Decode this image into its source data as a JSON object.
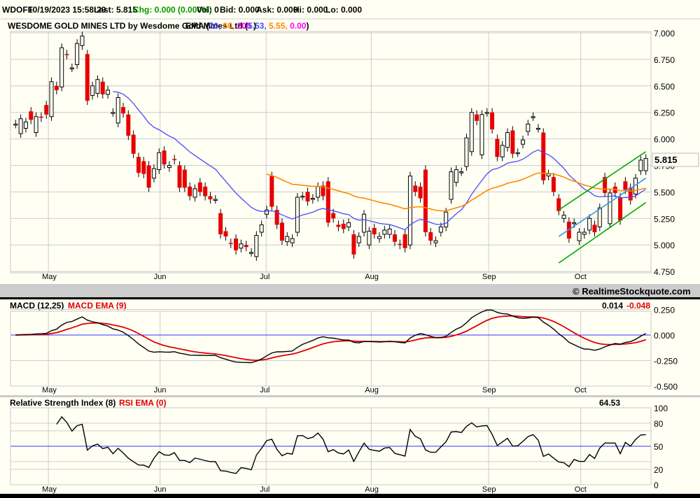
{
  "header": {
    "symbol": "WDOFF",
    "datetime": "10/19/2023 15:58:29",
    "last": "Last: 5.815",
    "chg": "Chg: 0.000 (0.000%)",
    "vol": "Vol: 0",
    "bid": "Bid: 0.000",
    "ask": "Ask: 0.000",
    "hi": "Hi: 0.000",
    "lo": "Lo: 0.000"
  },
  "legend": {
    "title": "WESDOME GOLD MINES LTD by Wesdome Gold Mines Ltd.",
    "ema_label": "EMA (",
    "ema_periods": [
      "20,",
      "50,",
      "200"
    ],
    "ema_close": ")",
    "val_open": "(",
    "ema_values": [
      "5.53,",
      "5.55,",
      "0.00"
    ],
    "val_close": ")"
  },
  "colors": {
    "up": "#fffff4",
    "down": "#e80000",
    "ema20": "#4a4aff",
    "ema50": "#ff8800",
    "ema200": "#ff00ff",
    "chg": "#009900",
    "channel": "#00aa00",
    "midline": "#3399ee",
    "macd": "#000000",
    "signal": "#e00000",
    "ref": "#3333ff"
  },
  "copyright": "© RealtimeStockquote.com",
  "last_price_tag": "5.815",
  "macd_panel": {
    "label": "MACD (12,25)",
    "signal_label": "MACD EMA (9)",
    "macd_value": "0.014",
    "signal_value": "-0.048",
    "ticks": [
      "0.250",
      "0.000",
      "-0.250",
      "-0.500"
    ],
    "tick_values": [
      0.25,
      0,
      -0.25,
      -0.5
    ]
  },
  "rsi_panel": {
    "label": "Relative Strength Index (8)",
    "ema_label": "RSI EMA (0)",
    "value": "64.53",
    "ticks": [
      "100",
      "80",
      "50",
      "20",
      "0"
    ],
    "tick_values": [
      100,
      80,
      50,
      20,
      0
    ]
  },
  "chart_data": {
    "type": "candlestick",
    "symbol": "WDOFF",
    "price_ticks": [
      "7.000",
      "6.750",
      "6.500",
      "6.250",
      "6.000",
      "5.750",
      "5.500",
      "5.250",
      "5.000",
      "4.750"
    ],
    "price_tick_values": [
      7.0,
      6.75,
      6.5,
      6.25,
      6.0,
      5.75,
      5.5,
      5.25,
      5.0,
      4.75
    ],
    "ylim": [
      4.75,
      7.0
    ],
    "months": [
      {
        "label": "May",
        "bar": 6.4
      },
      {
        "label": "Jun",
        "bar": 28.2
      },
      {
        "label": "Jul",
        "bar": 48.9
      },
      {
        "label": "Aug",
        "bar": 69.4
      },
      {
        "label": "Sep",
        "bar": 92.3
      },
      {
        "label": "Oct",
        "bar": 110.3
      }
    ],
    "bars_open_close": [
      [
        6.14,
        6.14
      ],
      [
        6.05,
        6.19
      ],
      [
        6.1,
        6.16
      ],
      [
        6.26,
        6.18
      ],
      [
        6.06,
        6.21
      ],
      [
        6.21,
        6.2
      ],
      [
        6.32,
        6.23
      ],
      [
        6.21,
        6.54
      ],
      [
        6.5,
        6.46
      ],
      [
        6.49,
        6.86
      ],
      [
        6.8,
        6.79
      ],
      [
        6.67,
        6.67
      ],
      [
        6.7,
        6.9
      ],
      [
        6.88,
        6.97
      ],
      [
        6.8,
        6.36
      ],
      [
        6.41,
        6.5
      ],
      [
        6.43,
        6.56
      ],
      [
        6.54,
        6.42
      ],
      [
        6.42,
        6.46
      ],
      [
        6.25,
        6.25
      ],
      [
        6.15,
        6.39
      ],
      [
        6.3,
        6.24
      ],
      [
        6.23,
        6.03
      ],
      [
        6.04,
        5.86
      ],
      [
        5.83,
        5.68
      ],
      [
        5.79,
        5.67
      ],
      [
        5.75,
        5.54
      ],
      [
        5.63,
        5.72
      ],
      [
        5.71,
        5.87
      ],
      [
        5.89,
        5.76
      ],
      [
        5.73,
        5.75
      ],
      [
        5.81,
        5.8
      ],
      [
        5.75,
        5.54
      ],
      [
        5.71,
        5.54
      ],
      [
        5.55,
        5.46
      ],
      [
        5.45,
        5.53
      ],
      [
        5.59,
        5.5
      ],
      [
        5.55,
        5.46
      ],
      [
        5.46,
        5.43
      ],
      [
        5.43,
        5.43
      ],
      [
        5.3,
        5.1
      ],
      [
        5.13,
        5.08
      ],
      [
        5.02,
        5.01
      ],
      [
        5.06,
        4.95
      ],
      [
        4.97,
        5.01
      ],
      [
        5.0,
        4.98
      ],
      [
        4.93,
        4.93
      ],
      [
        4.89,
        5.09
      ],
      [
        5.12,
        5.19
      ],
      [
        5.29,
        5.33
      ],
      [
        5.65,
        5.36
      ],
      [
        5.33,
        5.19
      ],
      [
        5.21,
        5.04
      ],
      [
        5.03,
        5.08
      ],
      [
        5.02,
        5.06
      ],
      [
        5.12,
        5.45
      ],
      [
        5.46,
        5.46
      ],
      [
        5.5,
        5.41
      ],
      [
        5.43,
        5.44
      ],
      [
        5.45,
        5.55
      ],
      [
        5.56,
        5.46
      ],
      [
        5.6,
        5.21
      ],
      [
        5.3,
        5.25
      ],
      [
        5.19,
        5.17
      ],
      [
        5.2,
        5.15
      ],
      [
        5.17,
        5.21
      ],
      [
        5.1,
        4.91
      ],
      [
        5.02,
        5.08
      ],
      [
        5.12,
        5.29
      ],
      [
        5.0,
        5.13
      ],
      [
        5.16,
        5.1
      ],
      [
        5.06,
        5.08
      ],
      [
        5.1,
        5.14
      ],
      [
        5.1,
        5.15
      ],
      [
        5.1,
        5.03
      ],
      [
        5.01,
        5.0
      ],
      [
        5.1,
        4.97
      ],
      [
        5.0,
        5.65
      ],
      [
        5.56,
        5.5
      ],
      [
        5.55,
        5.44
      ],
      [
        5.71,
        5.12
      ],
      [
        5.12,
        5.04
      ],
      [
        5.02,
        5.04
      ],
      [
        5.12,
        5.17
      ],
      [
        5.17,
        5.31
      ],
      [
        5.43,
        5.69
      ],
      [
        5.59,
        5.71
      ],
      [
        5.69,
        5.69
      ],
      [
        5.74,
        6.01
      ],
      [
        5.88,
        6.25
      ],
      [
        6.23,
        6.17
      ],
      [
        5.85,
        6.23
      ],
      [
        6.25,
        6.25
      ],
      [
        6.25,
        6.09
      ],
      [
        6.0,
        5.83
      ],
      [
        5.83,
        5.94
      ],
      [
        5.92,
        6.06
      ],
      [
        6.08,
        5.86
      ],
      [
        5.87,
        5.87
      ],
      [
        5.95,
        5.99
      ],
      [
        6.07,
        6.14
      ],
      [
        6.21,
        6.21
      ],
      [
        6.1,
        6.1
      ],
      [
        6.06,
        5.61
      ],
      [
        5.65,
        5.67
      ],
      [
        5.64,
        5.5
      ],
      [
        5.44,
        5.32
      ],
      [
        5.25,
        5.28
      ],
      [
        5.22,
        5.06
      ],
      [
        5.2,
        5.21
      ],
      [
        5.04,
        5.12
      ],
      [
        5.1,
        5.12
      ],
      [
        5.14,
        5.25
      ],
      [
        5.19,
        5.12
      ],
      [
        5.17,
        5.35
      ],
      [
        5.64,
        5.49
      ],
      [
        5.2,
        5.49
      ],
      [
        5.55,
        5.49
      ],
      [
        5.45,
        5.23
      ],
      [
        5.6,
        5.52
      ],
      [
        5.54,
        5.42
      ],
      [
        5.48,
        5.63
      ],
      [
        5.7,
        5.8
      ],
      [
        5.7,
        5.815
      ]
    ],
    "trendlines": [
      {
        "name": "channel-upper",
        "from": [
          106,
          5.33
        ],
        "to": [
          123,
          5.88
        ]
      },
      {
        "name": "channel-lower",
        "from": [
          106,
          4.83
        ],
        "to": [
          123,
          5.4
        ]
      },
      {
        "name": "channel-mid",
        "from": [
          106,
          5.08
        ],
        "to": [
          123,
          5.63
        ]
      }
    ],
    "indicators": {
      "ema_periods": [
        20,
        50
      ],
      "macd": [
        12,
        25,
        9
      ],
      "rsi": 8
    }
  }
}
